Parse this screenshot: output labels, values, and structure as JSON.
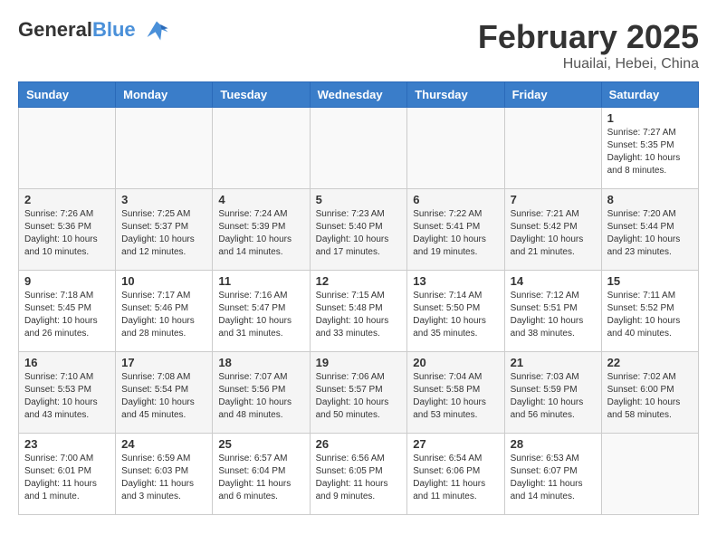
{
  "header": {
    "logo_general": "General",
    "logo_blue": "Blue",
    "month_title": "February 2025",
    "location": "Huailai, Hebei, China"
  },
  "weekdays": [
    "Sunday",
    "Monday",
    "Tuesday",
    "Wednesday",
    "Thursday",
    "Friday",
    "Saturday"
  ],
  "weeks": [
    [
      {
        "day": "",
        "info": ""
      },
      {
        "day": "",
        "info": ""
      },
      {
        "day": "",
        "info": ""
      },
      {
        "day": "",
        "info": ""
      },
      {
        "day": "",
        "info": ""
      },
      {
        "day": "",
        "info": ""
      },
      {
        "day": "1",
        "info": "Sunrise: 7:27 AM\nSunset: 5:35 PM\nDaylight: 10 hours\nand 8 minutes."
      }
    ],
    [
      {
        "day": "2",
        "info": "Sunrise: 7:26 AM\nSunset: 5:36 PM\nDaylight: 10 hours\nand 10 minutes."
      },
      {
        "day": "3",
        "info": "Sunrise: 7:25 AM\nSunset: 5:37 PM\nDaylight: 10 hours\nand 12 minutes."
      },
      {
        "day": "4",
        "info": "Sunrise: 7:24 AM\nSunset: 5:39 PM\nDaylight: 10 hours\nand 14 minutes."
      },
      {
        "day": "5",
        "info": "Sunrise: 7:23 AM\nSunset: 5:40 PM\nDaylight: 10 hours\nand 17 minutes."
      },
      {
        "day": "6",
        "info": "Sunrise: 7:22 AM\nSunset: 5:41 PM\nDaylight: 10 hours\nand 19 minutes."
      },
      {
        "day": "7",
        "info": "Sunrise: 7:21 AM\nSunset: 5:42 PM\nDaylight: 10 hours\nand 21 minutes."
      },
      {
        "day": "8",
        "info": "Sunrise: 7:20 AM\nSunset: 5:44 PM\nDaylight: 10 hours\nand 23 minutes."
      }
    ],
    [
      {
        "day": "9",
        "info": "Sunrise: 7:18 AM\nSunset: 5:45 PM\nDaylight: 10 hours\nand 26 minutes."
      },
      {
        "day": "10",
        "info": "Sunrise: 7:17 AM\nSunset: 5:46 PM\nDaylight: 10 hours\nand 28 minutes."
      },
      {
        "day": "11",
        "info": "Sunrise: 7:16 AM\nSunset: 5:47 PM\nDaylight: 10 hours\nand 31 minutes."
      },
      {
        "day": "12",
        "info": "Sunrise: 7:15 AM\nSunset: 5:48 PM\nDaylight: 10 hours\nand 33 minutes."
      },
      {
        "day": "13",
        "info": "Sunrise: 7:14 AM\nSunset: 5:50 PM\nDaylight: 10 hours\nand 35 minutes."
      },
      {
        "day": "14",
        "info": "Sunrise: 7:12 AM\nSunset: 5:51 PM\nDaylight: 10 hours\nand 38 minutes."
      },
      {
        "day": "15",
        "info": "Sunrise: 7:11 AM\nSunset: 5:52 PM\nDaylight: 10 hours\nand 40 minutes."
      }
    ],
    [
      {
        "day": "16",
        "info": "Sunrise: 7:10 AM\nSunset: 5:53 PM\nDaylight: 10 hours\nand 43 minutes."
      },
      {
        "day": "17",
        "info": "Sunrise: 7:08 AM\nSunset: 5:54 PM\nDaylight: 10 hours\nand 45 minutes."
      },
      {
        "day": "18",
        "info": "Sunrise: 7:07 AM\nSunset: 5:56 PM\nDaylight: 10 hours\nand 48 minutes."
      },
      {
        "day": "19",
        "info": "Sunrise: 7:06 AM\nSunset: 5:57 PM\nDaylight: 10 hours\nand 50 minutes."
      },
      {
        "day": "20",
        "info": "Sunrise: 7:04 AM\nSunset: 5:58 PM\nDaylight: 10 hours\nand 53 minutes."
      },
      {
        "day": "21",
        "info": "Sunrise: 7:03 AM\nSunset: 5:59 PM\nDaylight: 10 hours\nand 56 minutes."
      },
      {
        "day": "22",
        "info": "Sunrise: 7:02 AM\nSunset: 6:00 PM\nDaylight: 10 hours\nand 58 minutes."
      }
    ],
    [
      {
        "day": "23",
        "info": "Sunrise: 7:00 AM\nSunset: 6:01 PM\nDaylight: 11 hours\nand 1 minute."
      },
      {
        "day": "24",
        "info": "Sunrise: 6:59 AM\nSunset: 6:03 PM\nDaylight: 11 hours\nand 3 minutes."
      },
      {
        "day": "25",
        "info": "Sunrise: 6:57 AM\nSunset: 6:04 PM\nDaylight: 11 hours\nand 6 minutes."
      },
      {
        "day": "26",
        "info": "Sunrise: 6:56 AM\nSunset: 6:05 PM\nDaylight: 11 hours\nand 9 minutes."
      },
      {
        "day": "27",
        "info": "Sunrise: 6:54 AM\nSunset: 6:06 PM\nDaylight: 11 hours\nand 11 minutes."
      },
      {
        "day": "28",
        "info": "Sunrise: 6:53 AM\nSunset: 6:07 PM\nDaylight: 11 hours\nand 14 minutes."
      },
      {
        "day": "",
        "info": ""
      }
    ]
  ]
}
